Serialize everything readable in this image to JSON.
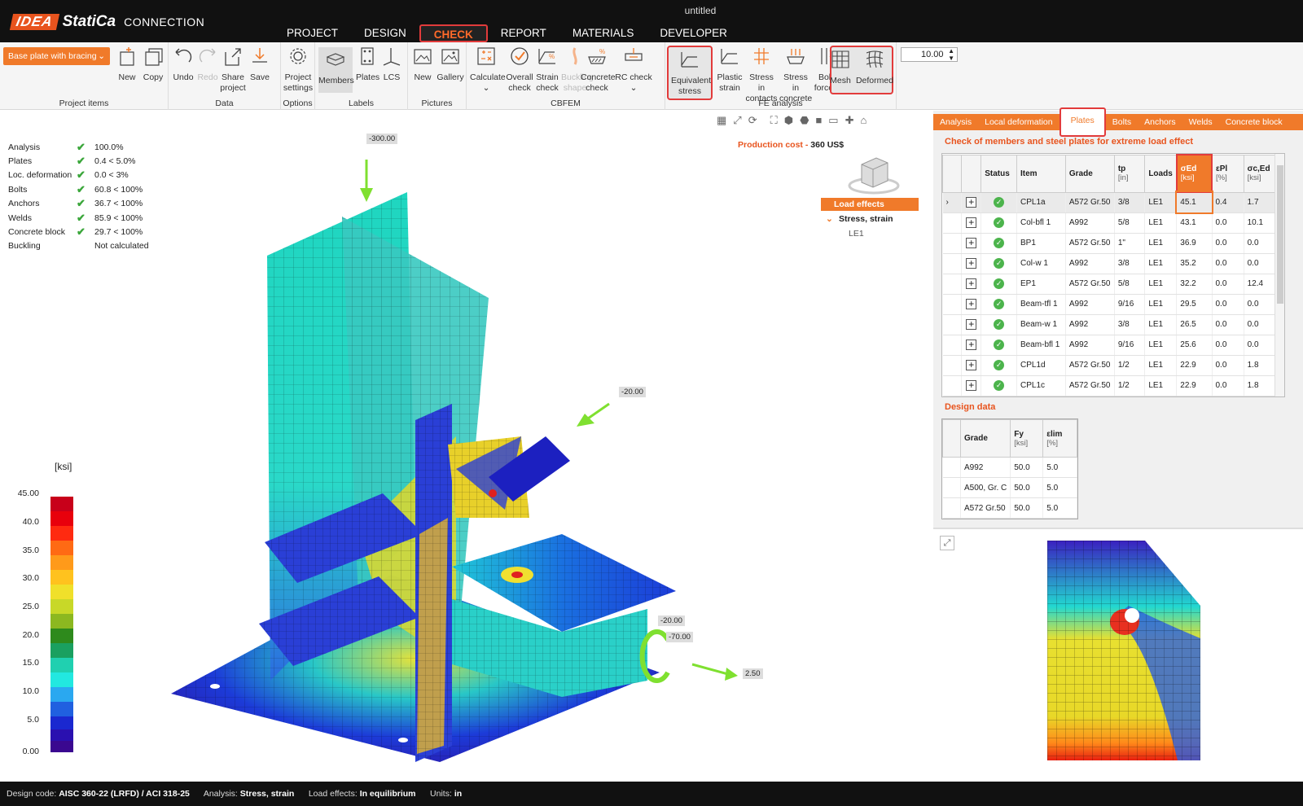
{
  "window": {
    "title": "untitled"
  },
  "app": {
    "brand1": "IDEA",
    "brand2": "StatiCa",
    "product": "CONNECTION"
  },
  "menu": [
    {
      "label": "PROJECT",
      "active": false
    },
    {
      "label": "DESIGN",
      "active": false
    },
    {
      "label": "CHECK",
      "active": true
    },
    {
      "label": "REPORT",
      "active": false
    },
    {
      "label": "MATERIALS",
      "active": false
    },
    {
      "label": "DEVELOPER",
      "active": false
    }
  ],
  "ribbon": {
    "project_dropdown": "Base plate with bracing",
    "groups": {
      "project_items": "Project items",
      "data": "Data",
      "options": "Options",
      "labels": "Labels",
      "pictures": "Pictures",
      "cbfem": "CBFEM",
      "fe_analysis": "FE analysis"
    },
    "buttons": {
      "new": "New",
      "copy": "Copy",
      "undo": "Undo",
      "redo": "Redo",
      "share1": "Share",
      "share2": "project",
      "save": "Save",
      "settings1": "Project",
      "settings2": "settings",
      "members": "Members",
      "plates": "Plates",
      "lcs": "LCS",
      "pic_new": "New",
      "gallery": "Gallery",
      "calculate": "Calculate",
      "overall1": "Overall",
      "overall2": "check",
      "strain1": "Strain",
      "strain2": "check",
      "buckling1": "Buckling",
      "buckling2": "shape",
      "concrete1": "Concrete",
      "concrete2": "check",
      "rc": "RC check",
      "eq1": "Equivalent",
      "eq2": "stress",
      "plastic1": "Plastic",
      "plastic2": "strain",
      "contacts1": "Stress in",
      "contacts2": "contacts",
      "sconc1": "Stress in",
      "sconc2": "concrete",
      "bolt1": "Bolt",
      "bolt2": "forces",
      "mesh": "Mesh",
      "deformed": "Deformed"
    },
    "scale_value": "10.00"
  },
  "viewport": {
    "status": [
      {
        "name": "Analysis",
        "ok": true,
        "value": "100.0%"
      },
      {
        "name": "Plates",
        "ok": true,
        "value": "0.4 < 5.0%"
      },
      {
        "name": "Loc. deformation",
        "ok": true,
        "value": "0.0 < 3%"
      },
      {
        "name": "Bolts",
        "ok": true,
        "value": "60.8 < 100%"
      },
      {
        "name": "Anchors",
        "ok": true,
        "value": "36.7 < 100%"
      },
      {
        "name": "Welds",
        "ok": true,
        "value": "85.9 < 100%"
      },
      {
        "name": "Concrete block",
        "ok": true,
        "value": "29.7 < 100%"
      },
      {
        "name": "Buckling",
        "ok": false,
        "value": "Not calculated"
      }
    ],
    "production_cost_label": "Production cost",
    "production_cost_value": "360 US$",
    "tree": {
      "root": "Load effects",
      "child": "Stress, strain",
      "leaf": "LE1"
    },
    "legend_unit": "[ksi]",
    "legend_ticks": [
      "45.00",
      "40.0",
      "35.0",
      "30.0",
      "25.0",
      "20.0",
      "15.0",
      "10.0",
      "5.0",
      "0.00"
    ],
    "loads": [
      "-300.00",
      "-20.00",
      "-20.00",
      "-70.00",
      "2.50"
    ]
  },
  "panel": {
    "tabs": [
      "Analysis",
      "Local deformation",
      "Plates",
      "Bolts",
      "Anchors",
      "Welds",
      "Concrete block"
    ],
    "active_tab": "Plates",
    "title": "Check of members and steel plates for extreme load effect",
    "columns": [
      {
        "h": "Status",
        "u": ""
      },
      {
        "h": "Item",
        "u": ""
      },
      {
        "h": "Grade",
        "u": ""
      },
      {
        "h": "tp",
        "u": "[in]"
      },
      {
        "h": "Loads",
        "u": ""
      },
      {
        "h": "σEd",
        "u": "[ksi]"
      },
      {
        "h": "εPl",
        "u": "[%]"
      },
      {
        "h": "σc,Ed",
        "u": "[ksi]"
      }
    ],
    "rows": [
      {
        "item": "CPL1a",
        "grade": "A572 Gr.50",
        "tp": "3/8",
        "loads": "LE1",
        "sed": "45.1",
        "epl": "0.4",
        "sced": "1.7"
      },
      {
        "item": "Col-bfl 1",
        "grade": "A992",
        "tp": "5/8",
        "loads": "LE1",
        "sed": "43.1",
        "epl": "0.0",
        "sced": "10.1"
      },
      {
        "item": "BP1",
        "grade": "A572 Gr.50",
        "tp": "1\"",
        "loads": "LE1",
        "sed": "36.9",
        "epl": "0.0",
        "sced": "0.0"
      },
      {
        "item": "Col-w 1",
        "grade": "A992",
        "tp": "3/8",
        "loads": "LE1",
        "sed": "35.2",
        "epl": "0.0",
        "sced": "0.0"
      },
      {
        "item": "EP1",
        "grade": "A572 Gr.50",
        "tp": "5/8",
        "loads": "LE1",
        "sed": "32.2",
        "epl": "0.0",
        "sced": "12.4"
      },
      {
        "item": "Beam-tfl 1",
        "grade": "A992",
        "tp": "9/16",
        "loads": "LE1",
        "sed": "29.5",
        "epl": "0.0",
        "sced": "0.0"
      },
      {
        "item": "Beam-w 1",
        "grade": "A992",
        "tp": "3/8",
        "loads": "LE1",
        "sed": "26.5",
        "epl": "0.0",
        "sced": "0.0"
      },
      {
        "item": "Beam-bfl 1",
        "grade": "A992",
        "tp": "9/16",
        "loads": "LE1",
        "sed": "25.6",
        "epl": "0.0",
        "sced": "0.0"
      },
      {
        "item": "CPL1d",
        "grade": "A572 Gr.50",
        "tp": "1/2",
        "loads": "LE1",
        "sed": "22.9",
        "epl": "0.0",
        "sced": "1.8"
      },
      {
        "item": "CPL1c",
        "grade": "A572 Gr.50",
        "tp": "1/2",
        "loads": "LE1",
        "sed": "22.9",
        "epl": "0.0",
        "sced": "1.8"
      }
    ],
    "design_title": "Design data",
    "design_columns": [
      {
        "h": "Grade",
        "u": ""
      },
      {
        "h": "Fy",
        "u": "[ksi]"
      },
      {
        "h": "εlim",
        "u": "[%]"
      }
    ],
    "design_rows": [
      {
        "grade": "A992",
        "fy": "50.0",
        "elim": "5.0"
      },
      {
        "grade": "A500, Gr. C",
        "fy": "50.0",
        "elim": "5.0"
      },
      {
        "grade": "A572 Gr.50",
        "fy": "50.0",
        "elim": "5.0"
      }
    ]
  },
  "footer": {
    "code_label": "Design code:",
    "code_value": "AISC 360-22 (LRFD) / ACI 318-25",
    "analysis_label": "Analysis:",
    "analysis_value": "Stress, strain",
    "load_label": "Load effects:",
    "load_value": "In equilibrium",
    "units_label": "Units:",
    "units_value": "in"
  },
  "colors": {
    "accent": "#f07a2a",
    "highlight": "#e23b3b",
    "ok": "#4cb44c"
  }
}
